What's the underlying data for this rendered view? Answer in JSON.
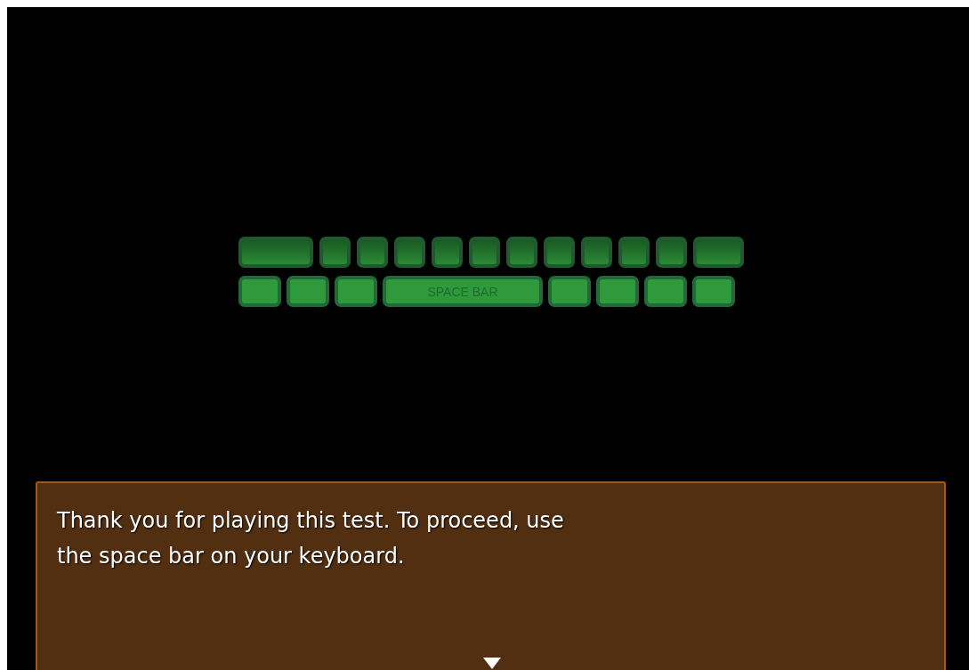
{
  "keyboard": {
    "rows": [
      {
        "keys": [
          {
            "kind": "wide",
            "highlighted": false
          },
          {
            "kind": "key",
            "highlighted": false
          },
          {
            "kind": "key",
            "highlighted": false
          },
          {
            "kind": "key",
            "highlighted": false
          },
          {
            "kind": "key",
            "highlighted": false
          },
          {
            "kind": "key",
            "highlighted": false
          },
          {
            "kind": "key",
            "highlighted": false
          },
          {
            "kind": "key",
            "highlighted": false
          },
          {
            "kind": "key",
            "highlighted": false
          },
          {
            "kind": "key",
            "highlighted": false
          },
          {
            "kind": "key",
            "highlighted": false
          },
          {
            "kind": "mid",
            "highlighted": false
          }
        ]
      },
      {
        "keys": [
          {
            "kind": "key2",
            "highlighted": true
          },
          {
            "kind": "key2",
            "highlighted": true
          },
          {
            "kind": "key2",
            "highlighted": true
          },
          {
            "kind": "space",
            "label": "SPACE BAR",
            "highlighted": true
          },
          {
            "kind": "key2",
            "highlighted": true
          },
          {
            "kind": "key2",
            "highlighted": true
          },
          {
            "kind": "key2",
            "highlighted": true
          },
          {
            "kind": "key2",
            "highlighted": true
          }
        ]
      }
    ]
  },
  "dialog": {
    "text": "Thank you for playing this test. To proceed, use\nthe space bar on your keyboard.",
    "more_indicator": true
  }
}
